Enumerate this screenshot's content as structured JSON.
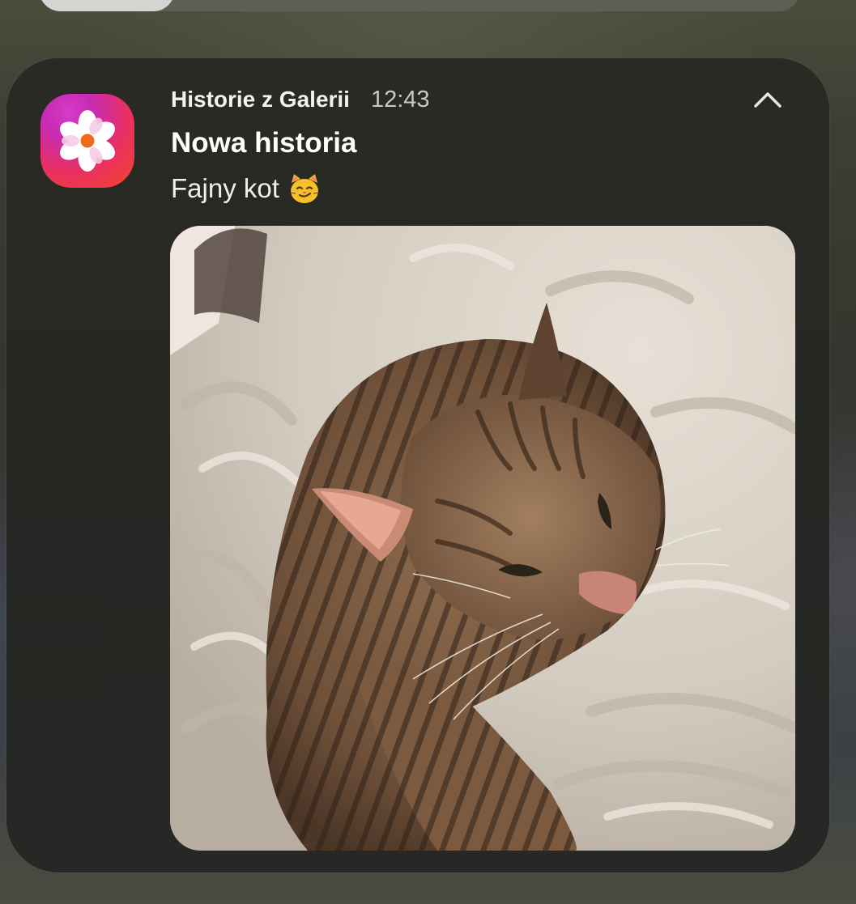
{
  "notification": {
    "app_name": "Historie z Galerii",
    "time": "12:43",
    "title": "Nowa historia",
    "body": "Fajny kot",
    "body_emoji": "smirking-cat-emoji",
    "app_icon": "gallery-flower-icon",
    "collapse_icon": "chevron-up-icon",
    "image": "tabby-cat-on-white-blanket-photo"
  },
  "colors": {
    "card_background": "#272823",
    "icon_gradient_start": "#c72bb3",
    "icon_gradient_end": "#f3452e",
    "title_text": "#ffffff",
    "secondary_text": "#c8c8c2"
  }
}
